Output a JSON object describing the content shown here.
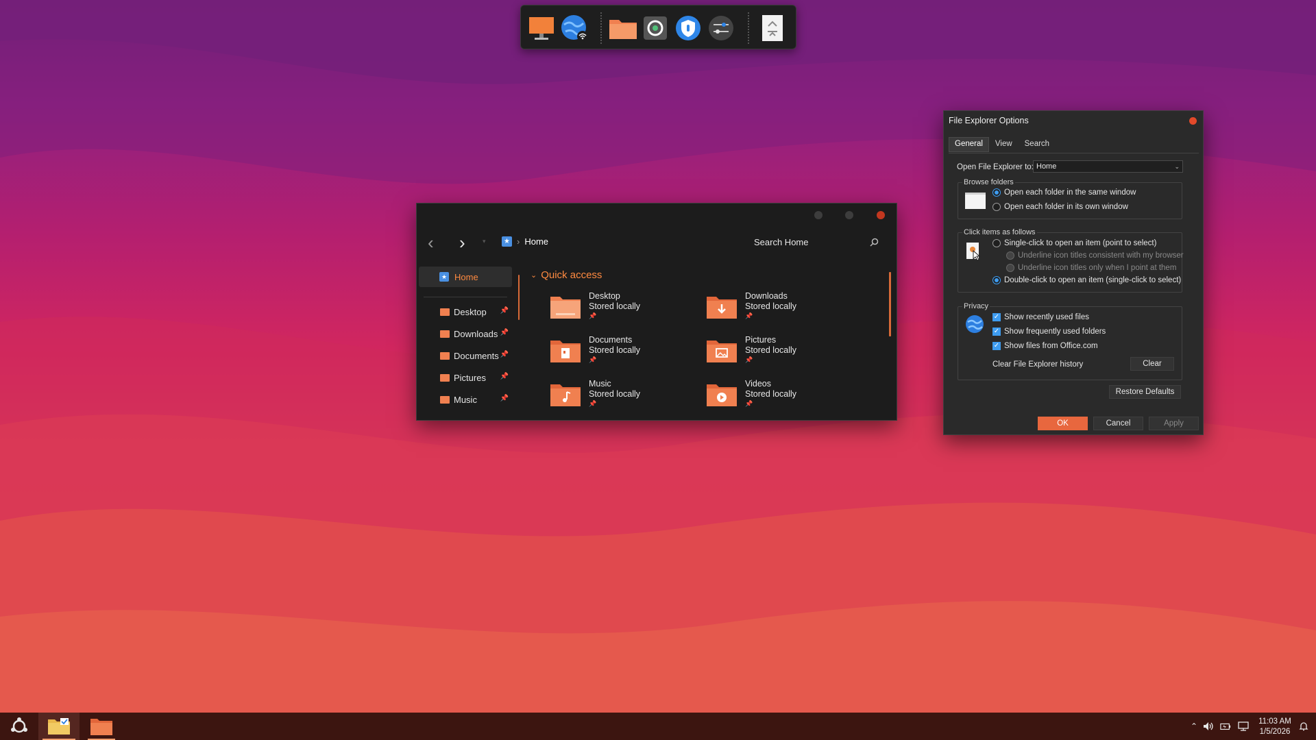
{
  "dock": {
    "items": [
      {
        "name": "this-pc-icon"
      },
      {
        "name": "network-icon"
      },
      {
        "name": "folder-icon"
      },
      {
        "name": "search-app-icon"
      },
      {
        "name": "security-shield-icon"
      },
      {
        "name": "settings-sliders-icon"
      },
      {
        "name": "recycle-bin-icon"
      }
    ]
  },
  "explorer": {
    "breadcrumb": "Home",
    "search_label": "Search Home",
    "sidebar": {
      "home_label": "Home",
      "items": [
        {
          "label": "Desktop"
        },
        {
          "label": "Downloads"
        },
        {
          "label": "Documents"
        },
        {
          "label": "Pictures"
        },
        {
          "label": "Music"
        }
      ]
    },
    "quick_access_label": "Quick access",
    "tiles": [
      {
        "name": "Desktop",
        "status": "Stored locally",
        "icon": "desktop-folder-icon"
      },
      {
        "name": "Downloads",
        "status": "Stored locally",
        "icon": "downloads-folder-icon"
      },
      {
        "name": "Documents",
        "status": "Stored locally",
        "icon": "documents-folder-icon"
      },
      {
        "name": "Pictures",
        "status": "Stored locally",
        "icon": "pictures-folder-icon"
      },
      {
        "name": "Music",
        "status": "Stored locally",
        "icon": "music-folder-icon"
      },
      {
        "name": "Videos",
        "status": "Stored locally",
        "icon": "videos-folder-icon"
      }
    ]
  },
  "dialog": {
    "title": "File Explorer Options",
    "tabs": [
      "General",
      "View",
      "Search"
    ],
    "active_tab": "General",
    "open_to_label": "Open File Explorer to:",
    "open_to_value": "Home",
    "browse_folders": {
      "title": "Browse folders",
      "options": [
        "Open each folder in the same window",
        "Open each folder in its own window"
      ],
      "selected": 0
    },
    "click_items": {
      "title": "Click items as follows",
      "single_click": "Single-click to open an item (point to select)",
      "underline_browser": "Underline icon titles consistent with my browser",
      "underline_point": "Underline icon titles only when I point at them",
      "double_click": "Double-click to open an item (single-click to select)",
      "selected": "double"
    },
    "privacy": {
      "title": "Privacy",
      "checks": [
        "Show recently used files",
        "Show frequently used folders",
        "Show files from Office.com"
      ],
      "clear_history_label": "Clear File Explorer history",
      "clear_button": "Clear"
    },
    "restore_defaults": "Restore Defaults",
    "ok": "OK",
    "cancel": "Cancel",
    "apply": "Apply"
  },
  "taskbar": {
    "time": "11:03 AM",
    "date": "1/5/2026"
  },
  "colors": {
    "accent": "#e8673e",
    "folder_orange": "#f08050",
    "selection_blue": "#3e9cf0"
  }
}
